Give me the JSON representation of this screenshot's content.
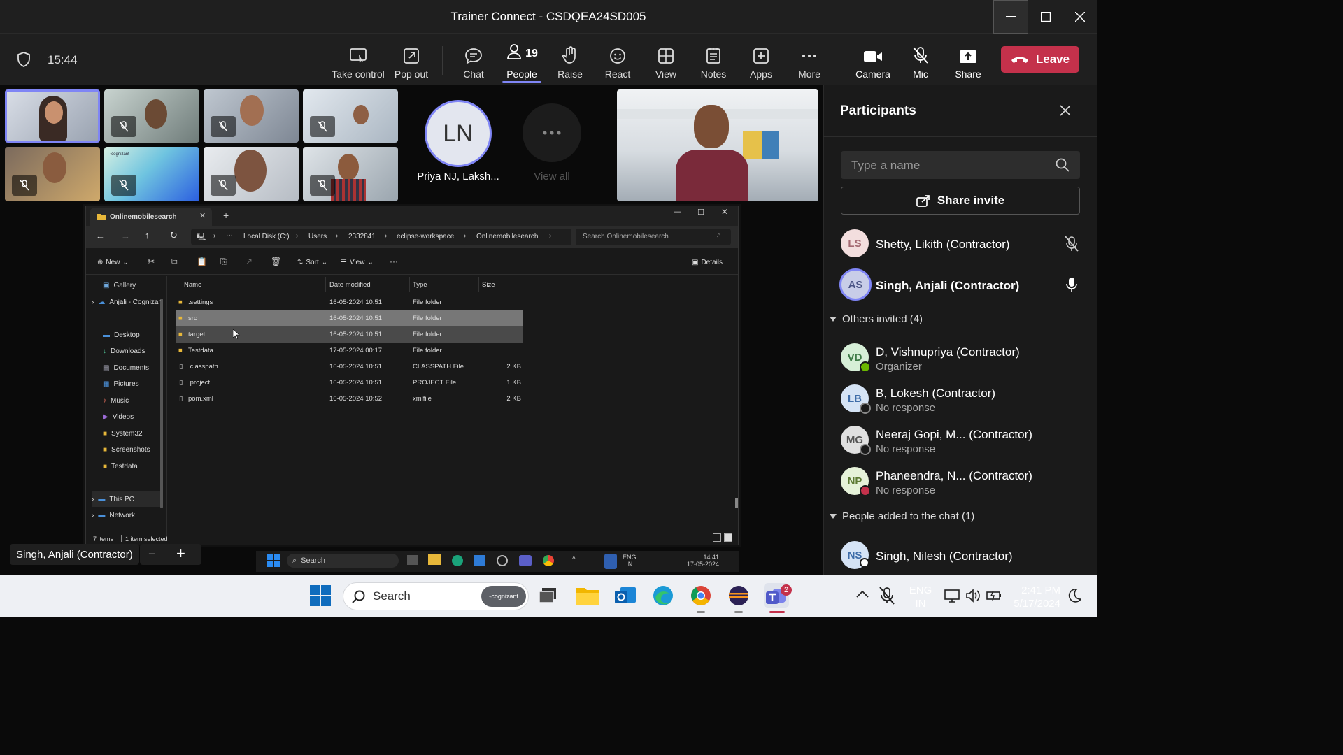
{
  "window": {
    "title": "Trainer Connect - CSDQEA24SD005"
  },
  "meeting": {
    "time": "15:44"
  },
  "toolbar": {
    "take_control": "Take control",
    "pop_out": "Pop out",
    "chat": "Chat",
    "people": "People",
    "people_count": "19",
    "raise": "Raise",
    "react": "React",
    "view": "View",
    "notes": "Notes",
    "apps": "Apps",
    "more": "More",
    "camera": "Camera",
    "mic": "Mic",
    "share": "Share",
    "leave": "Leave"
  },
  "stage": {
    "tile_ln_initials": "LN",
    "tile_ln_name": "Priya NJ, Laksh...",
    "view_all": "View all",
    "presenter_label": "Singh, Anjali (Contractor)"
  },
  "participants": {
    "title": "Participants",
    "search_placeholder": "Type a name",
    "share_invite": "Share invite",
    "in_meeting": [
      {
        "initials": "LS",
        "name": "Shetty, Likith (Contractor)"
      },
      {
        "initials": "AS",
        "name": "Singh, Anjali (Contractor)"
      }
    ],
    "others_invited_label": "Others invited (4)",
    "others_invited": [
      {
        "initials": "VD",
        "name": "D, Vishnupriya (Contractor)",
        "status": "Organizer"
      },
      {
        "initials": "LB",
        "name": "B, Lokesh (Contractor)",
        "status": "No response"
      },
      {
        "initials": "MG",
        "name": "Neeraj Gopi, M... (Contractor)",
        "status": "No response"
      },
      {
        "initials": "NP",
        "name": "Phaneendra, N... (Contractor)",
        "status": "No response"
      }
    ],
    "added_label": "People added to the chat (1)",
    "added": [
      {
        "initials": "NS",
        "name": "Singh, Nilesh (Contractor)"
      }
    ]
  },
  "explorer": {
    "tab_title": "Onlinemobilesearch",
    "breadcrumb": [
      "Local Disk (C:)",
      "Users",
      "2332841",
      "eclipse-workspace",
      "Onlinemobilesearch"
    ],
    "search_placeholder": "Search Onlinemobilesearch",
    "cmd": {
      "new": "New",
      "sort": "Sort",
      "view": "View",
      "details": "Details"
    },
    "sidebar": [
      "Gallery",
      "Anjali - Cognizar",
      "Desktop",
      "Downloads",
      "Documents",
      "Pictures",
      "Music",
      "Videos",
      "System32",
      "Screenshots",
      "Testdata",
      "This PC",
      "Network"
    ],
    "columns": {
      "name": "Name",
      "date": "Date modified",
      "type": "Type",
      "size": "Size"
    },
    "files": [
      {
        "name": ".settings",
        "date": "16-05-2024 10:51",
        "type": "File folder",
        "size": ""
      },
      {
        "name": "src",
        "date": "16-05-2024 10:51",
        "type": "File folder",
        "size": ""
      },
      {
        "name": "target",
        "date": "16-05-2024 10:51",
        "type": "File folder",
        "size": ""
      },
      {
        "name": "Testdata",
        "date": "17-05-2024 00:17",
        "type": "File folder",
        "size": ""
      },
      {
        "name": ".classpath",
        "date": "16-05-2024 10:51",
        "type": "CLASSPATH File",
        "size": "2 KB"
      },
      {
        "name": ".project",
        "date": "16-05-2024 10:51",
        "type": "PROJECT File",
        "size": "1 KB"
      },
      {
        "name": "pom.xml",
        "date": "16-05-2024 10:52",
        "type": "xmlfile",
        "size": "2 KB"
      }
    ],
    "status": {
      "items": "7 items",
      "selected": "1 item selected"
    }
  },
  "remote_taskbar": {
    "search": "Search",
    "lang1": "ENG",
    "lang2": "IN",
    "time": "14:41",
    "date": "17-05-2024"
  },
  "taskbar": {
    "search": "Search",
    "lang1": "ENG",
    "lang2": "IN",
    "time": "2:41 PM",
    "date": "5/17/2024",
    "teams_badge": "2"
  },
  "colors": {
    "accent": "#7f85f5",
    "leave": "#c4314b",
    "taskbar": "#eef0f4"
  }
}
